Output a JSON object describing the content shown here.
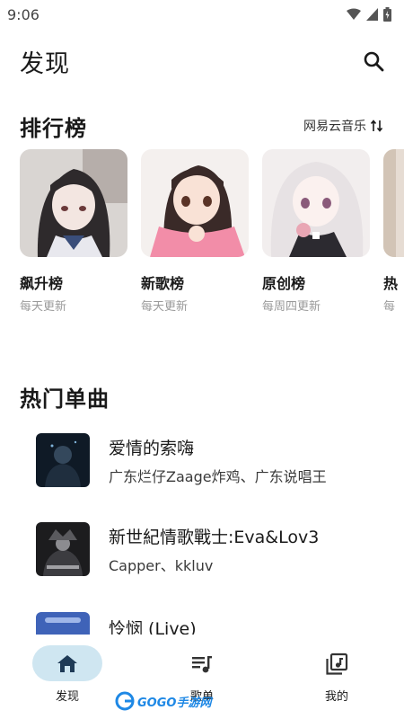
{
  "status_bar": {
    "time": "9:06"
  },
  "header": {
    "title": "发现"
  },
  "charts_section": {
    "title": "排行榜",
    "source_label": "网易云音乐",
    "cards": [
      {
        "name": "飙升榜",
        "subtitle": "每天更新"
      },
      {
        "name": "新歌榜",
        "subtitle": "每天更新"
      },
      {
        "name": "原创榜",
        "subtitle": "每周四更新"
      },
      {
        "name": "热",
        "subtitle": "每"
      }
    ]
  },
  "hot_section": {
    "title": "热门单曲",
    "songs": [
      {
        "title": "爱情的索嗨",
        "artist": "广东烂仔Zaage炸鸡、广东说唱王"
      },
      {
        "title": "新世紀情歌戰士:Eva&Lov3",
        "artist": "Capper、kkluv"
      },
      {
        "title": "怜悯 (Live)",
        "artist": ""
      }
    ]
  },
  "bottom_nav": {
    "items": [
      {
        "label": "发现",
        "icon": "home-icon",
        "active": true
      },
      {
        "label": "歌单",
        "icon": "playlist-icon",
        "active": false
      },
      {
        "label": "我的",
        "icon": "library-icon",
        "active": false
      }
    ]
  },
  "watermark": {
    "text": "GOGO手游网"
  },
  "colors": {
    "accent_pill": "#cfe6f1",
    "muted_text": "#9a9a9a",
    "nav_icon": "#1f3b57"
  }
}
